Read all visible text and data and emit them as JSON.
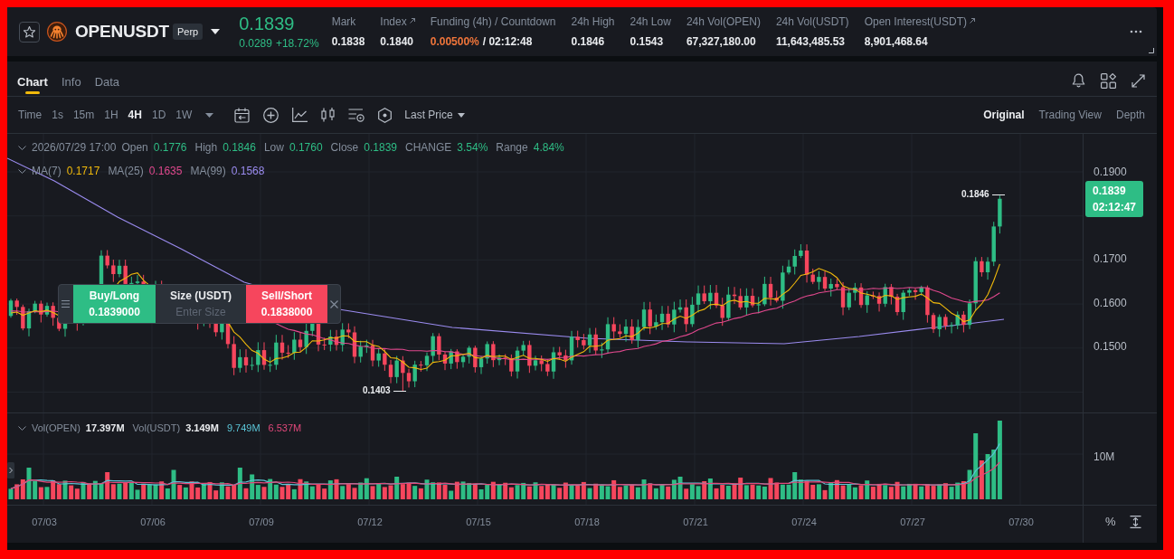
{
  "header": {
    "favorite": false,
    "symbol": "OPENUSDT",
    "badge": "Perp",
    "last_price": "0.1839",
    "change": "0.0289",
    "change_percent": "+18.72%",
    "stats": [
      {
        "kind": "plain",
        "label": "Mark",
        "value": "0.1838",
        "link": false
      },
      {
        "kind": "plain",
        "label": "Index",
        "value": "0.1840",
        "link": true
      },
      {
        "kind": "funding",
        "label": "Funding (4h) / Countdown",
        "value": "0.00500%",
        "countdown": "/ 02:12:48",
        "link": false
      },
      {
        "kind": "plain",
        "label": "24h High",
        "value": "0.1846",
        "link": false
      },
      {
        "kind": "plain",
        "label": "24h Low",
        "value": "0.1543",
        "link": false
      },
      {
        "kind": "plain",
        "label": "24h Vol(OPEN)",
        "value": "67,327,180.00",
        "link": false
      },
      {
        "kind": "plain",
        "label": "24h Vol(USDT)",
        "value": "11,643,485.53",
        "link": false
      },
      {
        "kind": "plain",
        "label": "Open Interest(USDT)",
        "value": "8,901,468.64",
        "link": true
      }
    ]
  },
  "tabs": [
    {
      "label": "Chart",
      "selected": true
    },
    {
      "label": "Info",
      "selected": false
    },
    {
      "label": "Data",
      "selected": false
    }
  ],
  "toolbar": {
    "intervals": [
      {
        "label": "Time",
        "selected": false
      },
      {
        "label": "1s",
        "selected": false
      },
      {
        "label": "15m",
        "selected": false
      },
      {
        "label": "1H",
        "selected": false
      },
      {
        "label": "4H",
        "selected": true
      },
      {
        "label": "1D",
        "selected": false
      },
      {
        "label": "1W",
        "selected": false
      }
    ],
    "price_source": "Last Price",
    "views": [
      {
        "label": "Original",
        "selected": true
      },
      {
        "label": "Trading View",
        "selected": false
      },
      {
        "label": "Depth",
        "selected": false
      }
    ]
  },
  "chart": {
    "legend": {
      "datetime": "2026/07/29 17:00",
      "fields": [
        {
          "label": "Open",
          "value": "0.1776"
        },
        {
          "label": "High",
          "value": "0.1846"
        },
        {
          "label": "Low",
          "value": "0.1760"
        },
        {
          "label": "Close",
          "value": "0.1839"
        },
        {
          "label": "CHANGE",
          "value": "3.54%"
        },
        {
          "label": "Range",
          "value": "4.84%"
        }
      ]
    },
    "ma_legend": [
      {
        "label": "MA(7)",
        "value": "0.1717",
        "color": "#f0b90b"
      },
      {
        "label": "MA(25)",
        "value": "0.1635",
        "color": "#e0488d"
      },
      {
        "label": "MA(99)",
        "value": "0.1568",
        "color": "#9b8cf0"
      }
    ],
    "high_marker": "0.1846",
    "low_marker": "0.1403",
    "price_axis": [
      "0.1900",
      "0.1700",
      "0.1600",
      "0.1500"
    ],
    "last_price_tag": {
      "price": "0.1839",
      "countdown": "02:12:47"
    },
    "volume_legend": {
      "items": [
        {
          "label": "Vol(OPEN)",
          "value": "17.397M"
        },
        {
          "label": "Vol(USDT)",
          "value": "3.149M"
        }
      ],
      "averages": [
        {
          "value": "9.749M",
          "color": "#5ac4d6"
        },
        {
          "value": "6.537M",
          "color": "#e0487a"
        }
      ]
    },
    "volume_axis": [
      "10M"
    ],
    "time_axis": [
      "07/03",
      "07/06",
      "07/09",
      "07/12",
      "07/15",
      "07/18",
      "07/21",
      "07/24",
      "07/27",
      "07/30"
    ],
    "percent_toggle": "%"
  },
  "order_widget": {
    "buy": {
      "label": "Buy/Long",
      "price": "0.1839000"
    },
    "size": {
      "label": "Size (USDT)",
      "placeholder": "Enter Size"
    },
    "sell": {
      "label": "Sell/Short",
      "price": "0.1838000"
    }
  }
}
